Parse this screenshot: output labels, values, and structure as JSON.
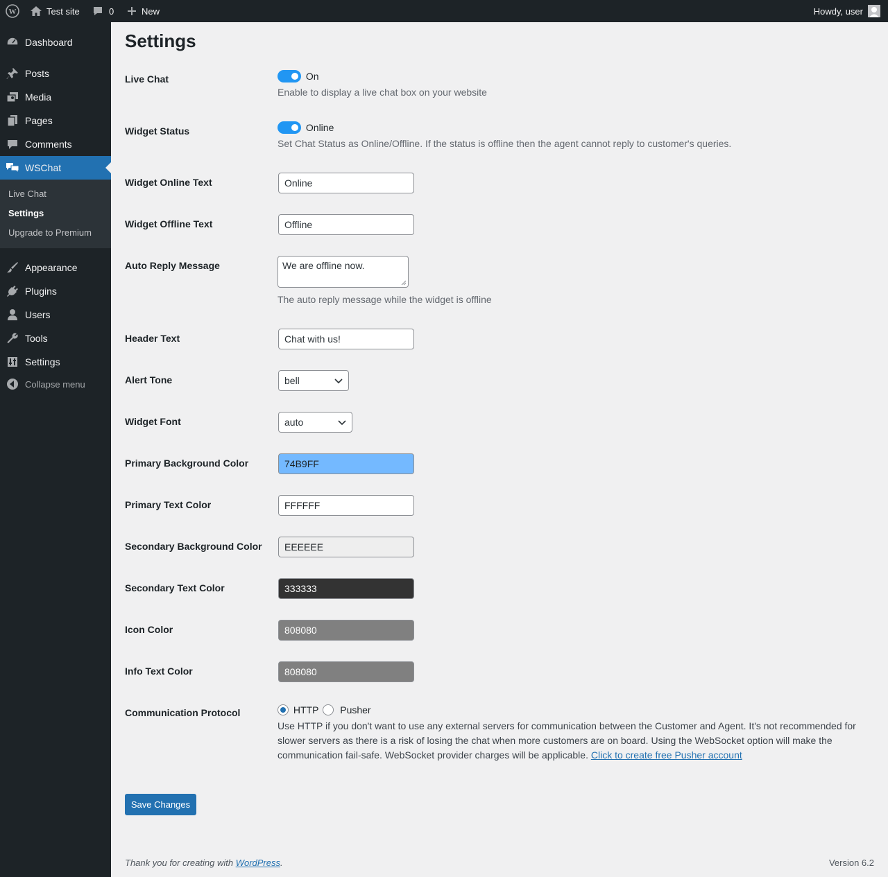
{
  "admin_bar": {
    "site_name": "Test site",
    "comments_count": "0",
    "new_label": "New",
    "howdy": "Howdy, user"
  },
  "sidebar": {
    "items": [
      {
        "label": "Dashboard",
        "icon": "dashboard-icon"
      },
      {
        "label": "Posts",
        "icon": "pin-icon"
      },
      {
        "label": "Media",
        "icon": "media-icon"
      },
      {
        "label": "Pages",
        "icon": "pages-icon"
      },
      {
        "label": "Comments",
        "icon": "comment-icon"
      },
      {
        "label": "WSChat",
        "icon": "chat-icon",
        "current": true
      },
      {
        "label": "Appearance",
        "icon": "brush-icon"
      },
      {
        "label": "Plugins",
        "icon": "plugin-icon"
      },
      {
        "label": "Users",
        "icon": "user-icon"
      },
      {
        "label": "Tools",
        "icon": "wrench-icon"
      },
      {
        "label": "Settings",
        "icon": "sliders-icon"
      }
    ],
    "submenu": [
      {
        "label": "Live Chat"
      },
      {
        "label": "Settings",
        "current": true
      },
      {
        "label": "Upgrade to Premium"
      }
    ],
    "collapse_label": "Collapse menu"
  },
  "page": {
    "title": "Settings",
    "live_chat": {
      "label": "Live Chat",
      "toggle_text": "On",
      "toggle_on": true,
      "description": "Enable to display a live chat box on your website"
    },
    "widget_status": {
      "label": "Widget Status",
      "toggle_text": "Online",
      "toggle_on": true,
      "description": "Set Chat Status as Online/Offline. If the status is offline then the agent cannot reply to customer's queries."
    },
    "widget_online_text": {
      "label": "Widget Online Text",
      "value": "Online"
    },
    "widget_offline_text": {
      "label": "Widget Offline Text",
      "value": "Offline"
    },
    "auto_reply": {
      "label": "Auto Reply Message",
      "value": "We are offline now.",
      "description": "The auto reply message while the widget is offline"
    },
    "header_text": {
      "label": "Header Text",
      "value": "Chat with us!"
    },
    "alert_tone": {
      "label": "Alert Tone",
      "value": "bell"
    },
    "widget_font": {
      "label": "Widget Font",
      "value": "auto"
    },
    "primary_bg": {
      "label": "Primary Background Color",
      "value": "74B9FF",
      "color": "#74B9FF"
    },
    "primary_text": {
      "label": "Primary Text Color",
      "value": "FFFFFF",
      "color": "#FFFFFF"
    },
    "secondary_bg": {
      "label": "Secondary Background Color",
      "value": "EEEEEE",
      "color": "#EEEEEE"
    },
    "secondary_text": {
      "label": "Secondary Text Color",
      "value": "333333",
      "color": "#333333"
    },
    "icon_color": {
      "label": "Icon Color",
      "value": "808080",
      "color": "#808080"
    },
    "info_text_color": {
      "label": "Info Text Color",
      "value": "808080",
      "color": "#808080"
    },
    "protocol": {
      "label": "Communication Protocol",
      "options": [
        "HTTP",
        "Pusher"
      ],
      "selected": "HTTP",
      "description": "Use HTTP if you don't want to use any external servers for communication between the Customer and Agent. It's not recommended for slower servers as there is a risk of losing the chat when more customers are on board. Using the WebSocket option will make the communication fail-safe. WebSocket provider charges will be applicable.",
      "link_text": "Click to create free Pusher account"
    },
    "save_label": "Save Changes"
  },
  "footer": {
    "thanks_prefix": "Thank you for creating with",
    "thanks_link": "WordPress",
    "thanks_suffix": ".",
    "version": "Version 6.2"
  }
}
